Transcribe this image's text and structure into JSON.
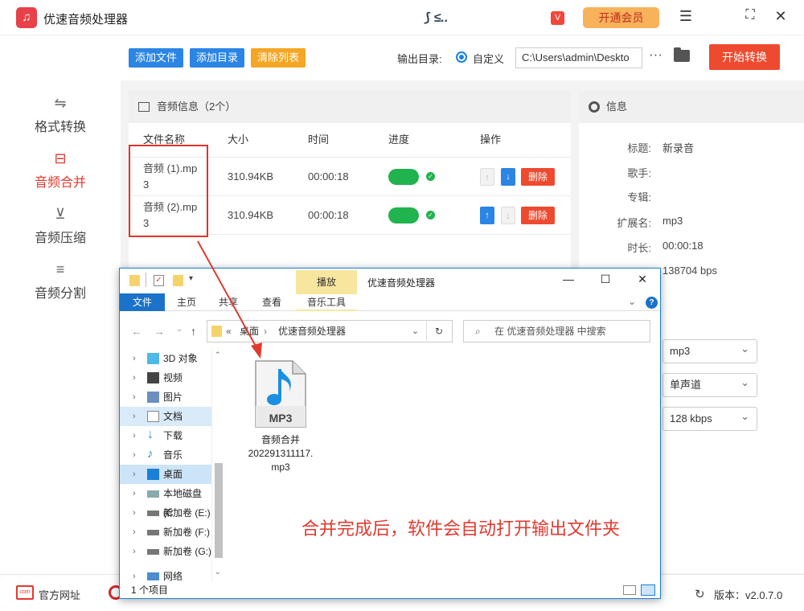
{
  "app": {
    "title": "优速音频处理器",
    "watermark": "⟆ ≤..",
    "vip_label": "开通会员"
  },
  "sidebar": {
    "items": [
      {
        "label": "格式转换",
        "icon": "swap-icon"
      },
      {
        "label": "音频合并",
        "icon": "merge-icon"
      },
      {
        "label": "音频压缩",
        "icon": "compress-icon"
      },
      {
        "label": "音频分割",
        "icon": "split-icon"
      }
    ]
  },
  "toolbar": {
    "add_file": "添加文件",
    "add_dir": "添加目录",
    "clear": "清除列表",
    "output_label": "输出目录:",
    "custom_label": "自定义",
    "output_path": "C:\\Users\\admin\\Deskto",
    "more": "···",
    "start": "开始转换"
  },
  "audio": {
    "header": "音频信息（2个）",
    "columns": [
      "文件名称",
      "大小",
      "时间",
      "进度",
      "操作"
    ],
    "rows": [
      {
        "name": "音频 (1).mp3",
        "size": "310.94KB",
        "time": "00:00:18"
      },
      {
        "name": "音频 (2).mp3",
        "size": "310.94KB",
        "time": "00:00:18"
      }
    ],
    "delete_label": "删除"
  },
  "info": {
    "header": "信息",
    "fields": [
      {
        "label": "标题:",
        "value": "新录音"
      },
      {
        "label": "歌手:",
        "value": ""
      },
      {
        "label": "专辑:",
        "value": ""
      },
      {
        "label": "扩展名:",
        "value": "mp3"
      },
      {
        "label": "时长:",
        "value": "00:00:18"
      },
      {
        "label": "码率:",
        "value": "138704 bps"
      }
    ],
    "format": "mp3",
    "channel": "单声道",
    "bitrate": "128 kbps"
  },
  "footer": {
    "website": "官方网址",
    "version": "版本：v2.0.7.0"
  },
  "explorer": {
    "context_tab": "播放",
    "window_title": "优速音频处理器",
    "ribbon_tabs": [
      "文件",
      "主页",
      "共享",
      "查看",
      "音乐工具"
    ],
    "address": [
      "«",
      "桌面",
      "›",
      "优速音频处理器"
    ],
    "search_placeholder": "在 优速音频处理器 中搜索",
    "tree": [
      "3D 对象",
      "视频",
      "图片",
      "文档",
      "下载",
      "音乐",
      "桌面",
      "本地磁盘 (C",
      "新加卷 (E:)",
      "新加卷 (F:)",
      "新加卷 (G:)",
      "网络"
    ],
    "file_badge": "MP3",
    "file_name_line1": "音频合并",
    "file_name_line2": "202291311117.",
    "file_name_line3": "mp3",
    "note": "合并完成后，软件会自动打开输出文件夹",
    "status": "1 个项目"
  },
  "colors": {
    "accent": "#e03a2f",
    "primary": "#2b85e4",
    "success": "#21b34e",
    "orange": "#f5a623",
    "start": "#ee4a2f"
  }
}
